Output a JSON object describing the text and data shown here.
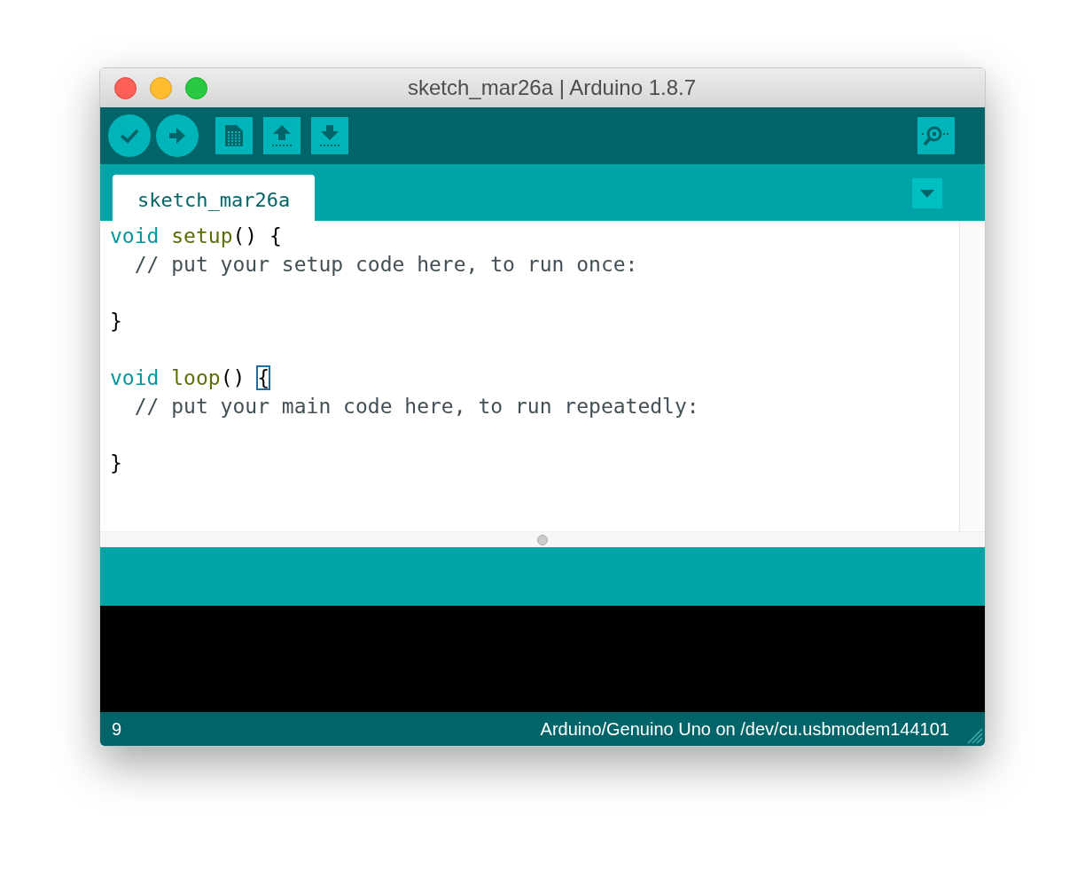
{
  "window": {
    "title": "sketch_mar26a | Arduino 1.8.7"
  },
  "tabs": [
    {
      "label": "sketch_mar26a",
      "selected": true
    }
  ],
  "code_lines": [
    {
      "kind": "code",
      "tokens": [
        {
          "kind": "keyword",
          "text": "void "
        },
        {
          "kind": "function",
          "text": "setup"
        },
        {
          "kind": "plain",
          "text": "() {"
        }
      ]
    },
    {
      "kind": "code",
      "tokens": [
        {
          "kind": "comment",
          "text": "  // put your setup code here, to run once:"
        }
      ]
    },
    {
      "kind": "blank"
    },
    {
      "kind": "code",
      "tokens": [
        {
          "kind": "plain",
          "text": "}"
        }
      ]
    },
    {
      "kind": "blank"
    },
    {
      "kind": "code",
      "tokens": [
        {
          "kind": "keyword",
          "text": "void "
        },
        {
          "kind": "function",
          "text": "loop"
        },
        {
          "kind": "plain",
          "text": "() "
        },
        {
          "kind": "bracket_match",
          "text": "{"
        }
      ]
    },
    {
      "kind": "code",
      "tokens": [
        {
          "kind": "comment",
          "text": "  // put your main code here, to run repeatedly:"
        }
      ]
    },
    {
      "kind": "blank"
    },
    {
      "kind": "code",
      "tokens": [
        {
          "kind": "plain",
          "text": "}"
        }
      ]
    }
  ],
  "status_bar": {
    "line_number": "9",
    "board": "Arduino/Genuino Uno on /dev/cu.usbmodem144101"
  }
}
